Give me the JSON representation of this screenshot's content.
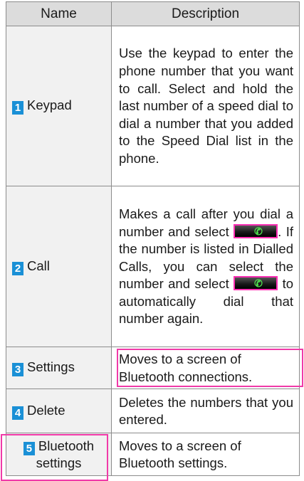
{
  "header": {
    "name": "Name",
    "description": "Description"
  },
  "rows": [
    {
      "num": "1",
      "name": "Keypad",
      "description": "Use the keypad to enter the phone number that you want to call. Select and hold the last number of a speed dial to dial a number that you added to the Speed Dial list in the phone."
    },
    {
      "num": "2",
      "name": "Call",
      "description_part1": "Makes a call after you dial a number and select",
      "description_part2": ". If the number is listed in Dialled Calls, you can select the number and select",
      "description_part3": "to automatically dial that number again."
    },
    {
      "num": "3",
      "name": "Settings",
      "description": "Moves to a screen of Bluetooth connections."
    },
    {
      "num": "4",
      "name": "Delete",
      "description": "Deletes the numbers that you entered."
    },
    {
      "num": "5",
      "name_line1": "Bluetooth",
      "name_line2": "settings",
      "description": "Moves to a screen of Bluetooth settings."
    }
  ],
  "colors": {
    "number_badge": "#1a90d6",
    "highlight": "#f03aa8",
    "header_bg": "#dcdcdc"
  },
  "icons": {
    "call_button": "phone-handset-icon"
  }
}
